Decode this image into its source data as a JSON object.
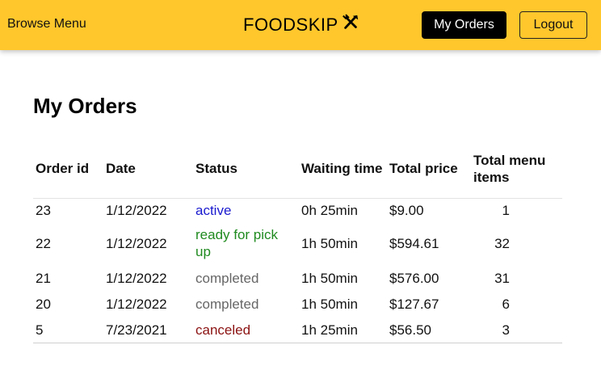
{
  "nav": {
    "browse_label": "Browse Menu",
    "brand": "FOODSKIP",
    "brand_icon": "fork-knife-icon",
    "orders_label": "My Orders",
    "logout_label": "Logout"
  },
  "colors": {
    "navbar": "#ffc72c",
    "orders_button": "#000000",
    "status_active": "#1a1acf",
    "status_ready": "#1f8a1f",
    "status_completed": "#666666",
    "status_canceled": "#8b1111"
  },
  "page": {
    "title": "My Orders"
  },
  "table": {
    "headers": {
      "order_id": "Order id",
      "date": "Date",
      "status": "Status",
      "waiting_time": "Waiting time",
      "total_price": "Total price",
      "total_items": "Total menu items"
    },
    "rows": [
      {
        "order_id": "23",
        "date": "1/12/2022",
        "status": "active",
        "waiting_time": "0h 25min",
        "total_price": "$9.00",
        "total_items": "1"
      },
      {
        "order_id": "22",
        "date": "1/12/2022",
        "status": "ready for pick up",
        "waiting_time": "1h 50min",
        "total_price": "$594.61",
        "total_items": "32"
      },
      {
        "order_id": "21",
        "date": "1/12/2022",
        "status": "completed",
        "waiting_time": "1h 50min",
        "total_price": "$576.00",
        "total_items": "31"
      },
      {
        "order_id": "20",
        "date": "1/12/2022",
        "status": "completed",
        "waiting_time": "1h 50min",
        "total_price": "$127.67",
        "total_items": "6"
      },
      {
        "order_id": "5",
        "date": "7/23/2021",
        "status": "canceled",
        "waiting_time": "1h 25min",
        "total_price": "$56.50",
        "total_items": "3"
      }
    ]
  }
}
